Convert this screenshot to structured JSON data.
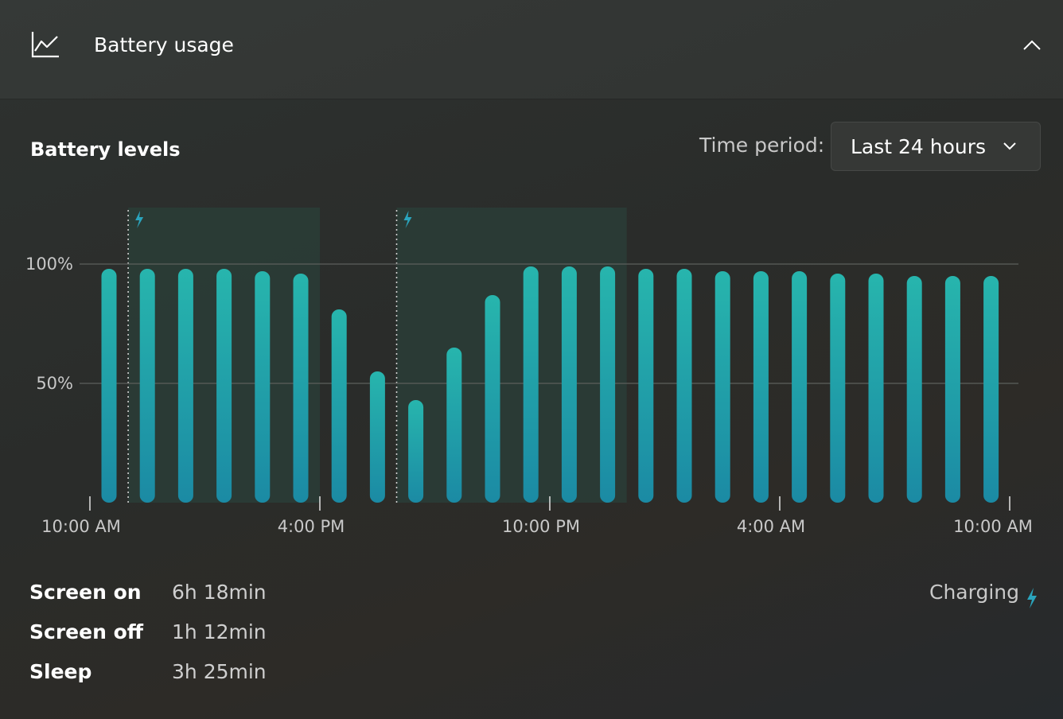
{
  "header": {
    "title": "Battery usage"
  },
  "section": {
    "title": "Battery levels",
    "period_label": "Time period:",
    "period_value": "Last 24 hours"
  },
  "colors": {
    "bar_top": "#27b5ad",
    "bar_bottom": "#1b8aa4",
    "charging_shade": "#2a3d37",
    "bolt": "#2aa4bd"
  },
  "chart_data": {
    "type": "bar",
    "ylabel": "",
    "ylim": [
      0,
      100
    ],
    "yticks": [
      "100%",
      "50%"
    ],
    "ytick_values": [
      100,
      50
    ],
    "xticks": [
      "10:00 AM",
      "4:00 PM",
      "10:00 PM",
      "4:00 AM",
      "10:00 AM"
    ],
    "grid": true,
    "charging_periods": [
      {
        "start_bar": 0.5,
        "end_bar": 5.5
      },
      {
        "start_bar": 7.5,
        "end_bar": 13.5
      }
    ],
    "series": [
      {
        "values": [
          98,
          98,
          98,
          98,
          97,
          96,
          81,
          55,
          43,
          65,
          87,
          99,
          99,
          99,
          98,
          98,
          97,
          97,
          97,
          96,
          96,
          95,
          95,
          95
        ]
      }
    ]
  },
  "stats": {
    "screen_on_label": "Screen on",
    "screen_on_value": "6h 18min",
    "screen_off_label": "Screen off",
    "screen_off_value": "1h 12min",
    "sleep_label": "Sleep",
    "sleep_value": "3h 25min",
    "charging_label": "Charging"
  }
}
